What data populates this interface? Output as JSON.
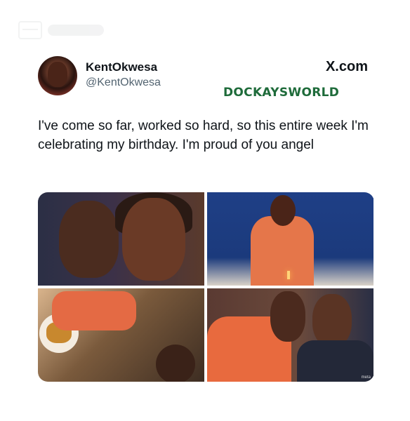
{
  "tweet": {
    "display_name": "KentOkwesa",
    "handle": "@KentOkwesa",
    "text": "I've come so far, worked so hard, so this entire week I'm celebrating my birthday. I'm proud of you angel"
  },
  "site_label": "X.com",
  "brand_watermark": "DOCKAYSWORLD",
  "photos": [
    {
      "alt": "selfie-couple"
    },
    {
      "alt": "woman-birthday-candle"
    },
    {
      "alt": "dinner-table-group"
    },
    {
      "alt": "couple-selfie-orange-coat"
    }
  ],
  "photo_corner_tag": "meta",
  "colors": {
    "brand_green": "#1e6b3a",
    "text": "#0f1419",
    "muted": "#536471"
  }
}
